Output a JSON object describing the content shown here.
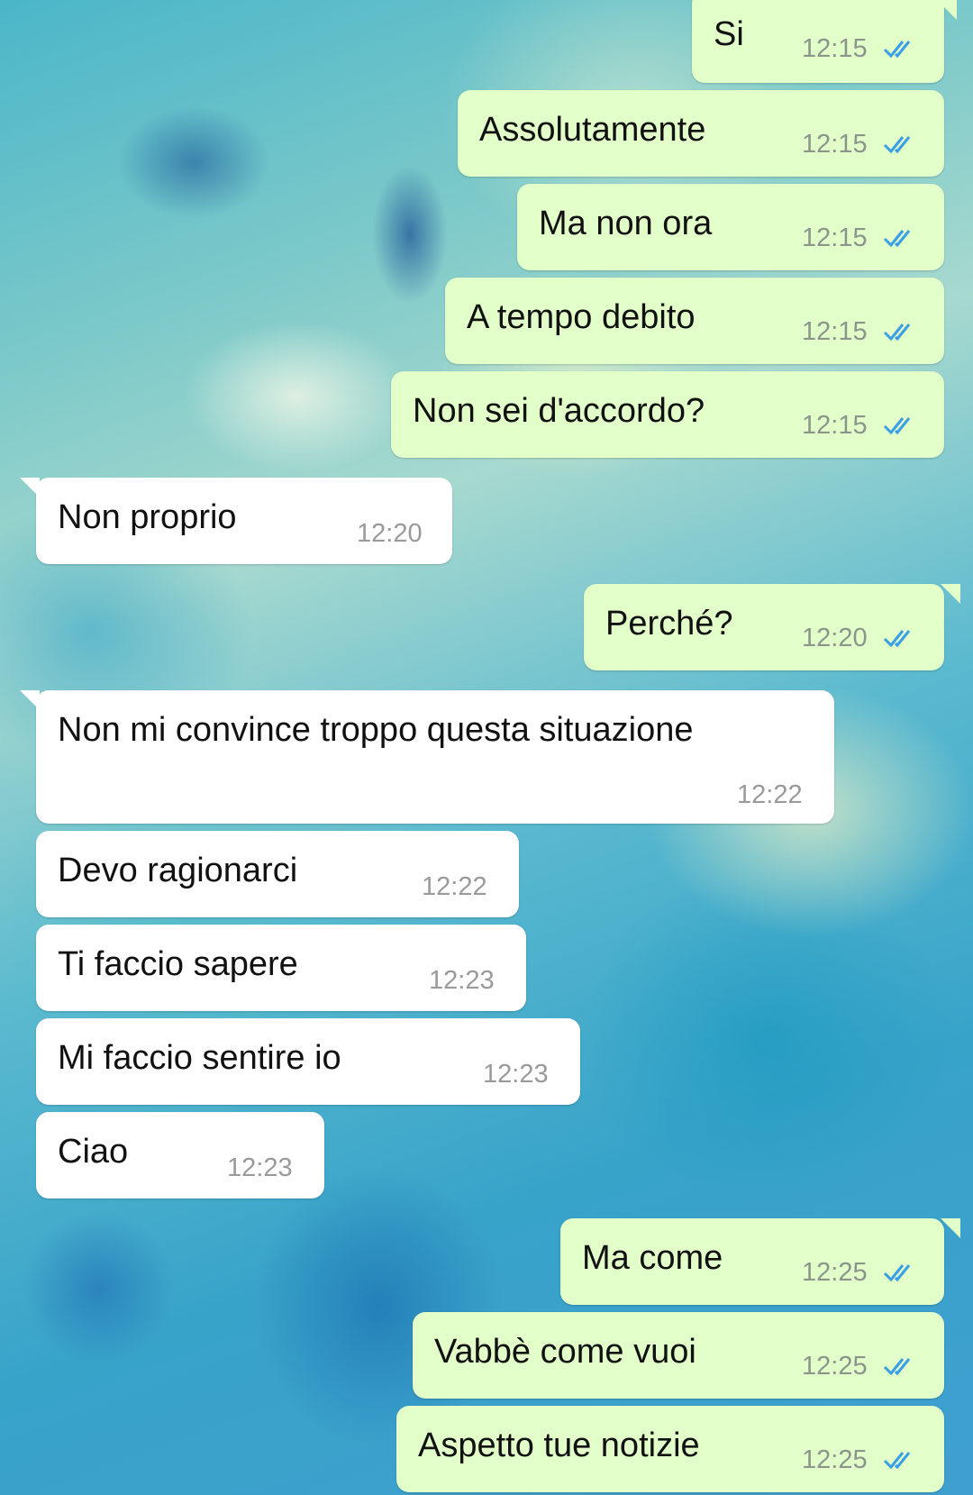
{
  "conversation": {
    "messages": [
      {
        "direction": "out",
        "text": "Si",
        "time": "12:15",
        "status": "read"
      },
      {
        "direction": "out",
        "text": "Assolutamente",
        "time": "12:15",
        "status": "read"
      },
      {
        "direction": "out",
        "text": "Ma non ora",
        "time": "12:15",
        "status": "read"
      },
      {
        "direction": "out",
        "text": "A tempo debito",
        "time": "12:15",
        "status": "read"
      },
      {
        "direction": "out",
        "text": "Non sei d'accordo?",
        "time": "12:15",
        "status": "read"
      },
      {
        "direction": "in",
        "text": "Non proprio",
        "time": "12:20"
      },
      {
        "direction": "out",
        "text": "Perché?",
        "time": "12:20",
        "status": "read"
      },
      {
        "direction": "in",
        "text": "Non mi convince troppo questa situazione",
        "time": "12:22"
      },
      {
        "direction": "in",
        "text": "Devo ragionarci",
        "time": "12:22"
      },
      {
        "direction": "in",
        "text": "Ti faccio sapere",
        "time": "12:23"
      },
      {
        "direction": "in",
        "text": "Mi faccio sentire io",
        "time": "12:23"
      },
      {
        "direction": "in",
        "text": "Ciao",
        "time": "12:23"
      },
      {
        "direction": "out",
        "text": "Ma come",
        "time": "12:25",
        "status": "read"
      },
      {
        "direction": "out",
        "text": "Vabbè come vuoi",
        "time": "12:25",
        "status": "read"
      },
      {
        "direction": "out",
        "text": "Aspetto tue notizie",
        "time": "12:25",
        "status": "read"
      }
    ]
  },
  "colors": {
    "outgoing_bubble": "#e2fec9",
    "incoming_bubble": "#ffffff",
    "read_ticks": "#3a9fe4"
  },
  "icons": {
    "read_receipt": "double-check-icon"
  }
}
